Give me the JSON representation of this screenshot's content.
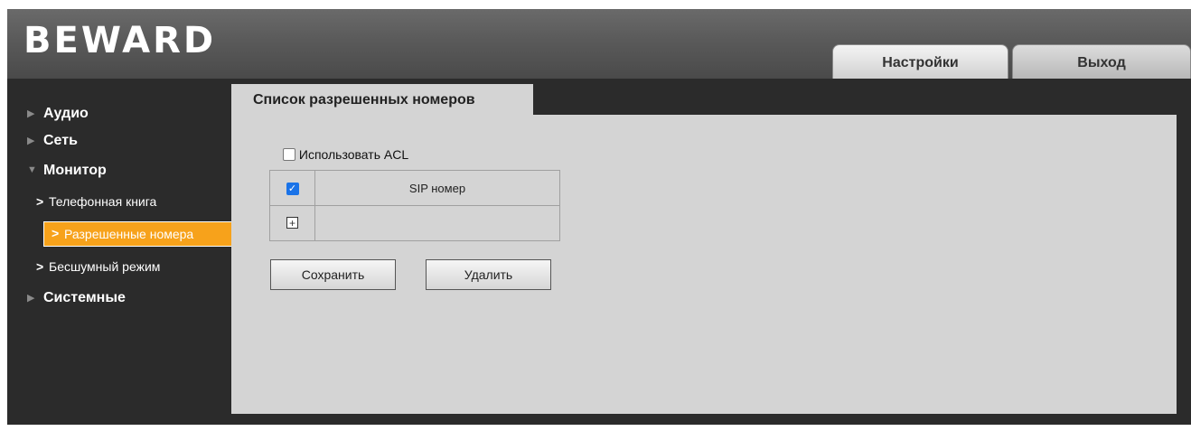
{
  "header": {
    "logo": "BEWARD",
    "tabs": [
      {
        "label": "Настройки",
        "active": true
      },
      {
        "label": "Выход",
        "active": false
      }
    ]
  },
  "sidebar": {
    "groups": [
      {
        "label": "Аудио",
        "expanded": false
      },
      {
        "label": "Сеть",
        "expanded": false
      },
      {
        "label": "Монитор",
        "expanded": true
      },
      {
        "label": "Системные",
        "expanded": false
      }
    ],
    "monitor_items": [
      {
        "label": "Телефонная книга",
        "active": false
      },
      {
        "label": "Разрешенные номера",
        "active": true
      },
      {
        "label": "Бесшумный режим",
        "active": false
      }
    ]
  },
  "content": {
    "tab_title": "Список разрешенных номеров",
    "acl_label": "Использовать ACL",
    "acl_checked": false,
    "table": {
      "header_checked": true,
      "column_header": "SIP номер",
      "rows": []
    },
    "save_button": "Сохранить",
    "delete_button": "Удалить"
  },
  "colors": {
    "accent": "#f7a21b",
    "panel": "#d4d4d4",
    "sidebar_bg": "#2b2b2b"
  }
}
